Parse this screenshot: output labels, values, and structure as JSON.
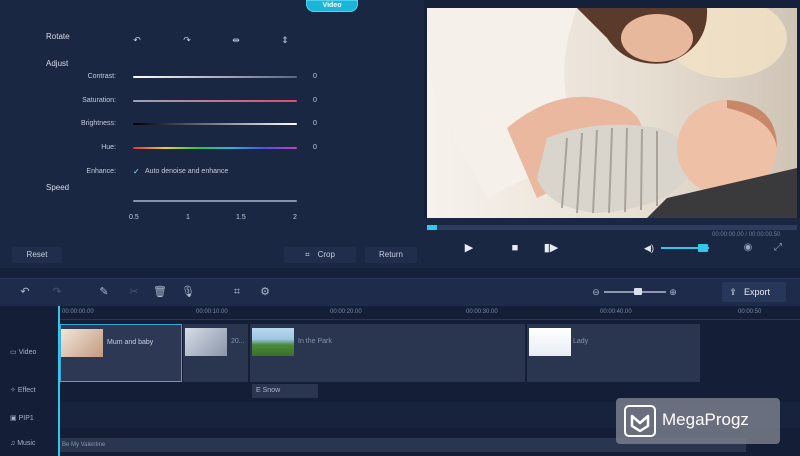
{
  "edit_panel": {
    "tab_label": "Video",
    "rotate_label": "Rotate",
    "adjust_label": "Adjust",
    "sliders": [
      {
        "label": "Contrast:",
        "value": "0"
      },
      {
        "label": "Saturation:",
        "value": "0"
      },
      {
        "label": "Brightness:",
        "value": "0"
      },
      {
        "label": "Hue:",
        "value": "0"
      }
    ],
    "enhance_label": "Enhance:",
    "enhance_option": "Auto denoise and enhance",
    "speed_label": "Speed",
    "speed_ticks": [
      "0.5",
      "1",
      "1.5",
      "2"
    ],
    "reset_label": "Reset",
    "crop_label": "Crop",
    "return_label": "Return"
  },
  "player": {
    "time": "00:00:00.00 / 00:00:00.50"
  },
  "toolbar": {
    "export_label": "Export"
  },
  "timeline": {
    "ruler": [
      "00:00:00.00",
      "00:00:10.00",
      "00:00:20.00",
      "00:00:30.00",
      "00:00:40.00",
      "00:00:50"
    ],
    "tracks": {
      "video": "Video",
      "effect": "Effect",
      "pip": "PIP1",
      "music": "Music"
    },
    "clips": [
      {
        "label": "Mum and baby"
      },
      {
        "label": "20..."
      },
      {
        "label": "In the Park"
      },
      {
        "label": "Lady"
      }
    ],
    "effect_clip": "E Snow",
    "music_clip": "Be My Valentine"
  },
  "watermark": {
    "text": "MegaProgz"
  }
}
